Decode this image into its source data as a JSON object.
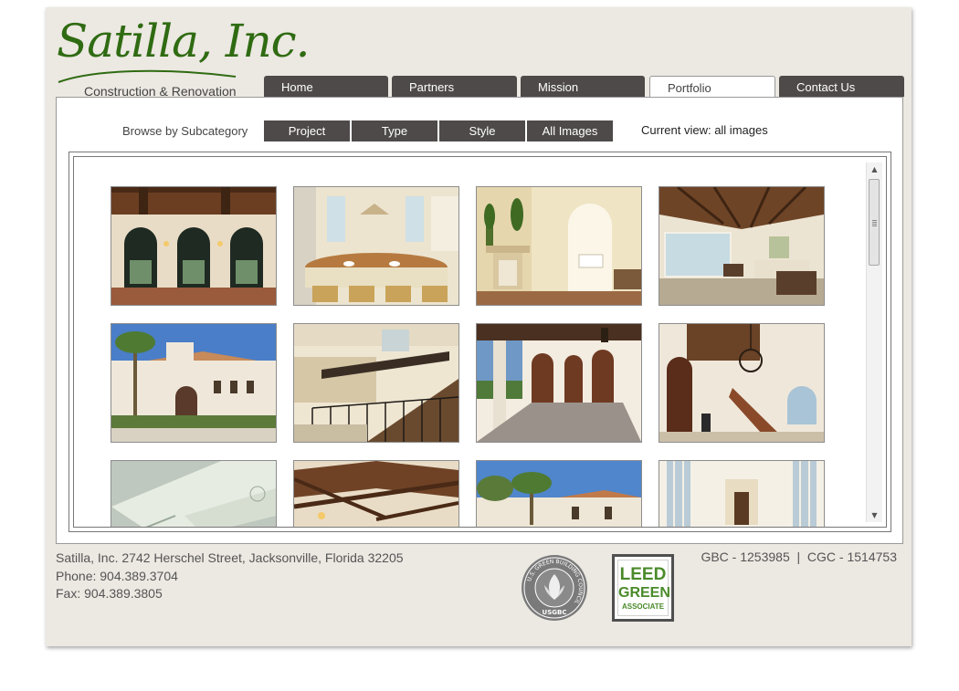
{
  "logo": {
    "name": "Satilla, Inc.",
    "tagline": "Construction & Renovation",
    "brand_color": "#2f6b12"
  },
  "nav": {
    "tabs": [
      {
        "label": "Home",
        "active": false
      },
      {
        "label": "Partners",
        "active": false
      },
      {
        "label": "Mission",
        "active": false
      },
      {
        "label": "Portfolio",
        "active": true
      },
      {
        "label": "Contact Us",
        "active": false
      }
    ]
  },
  "browse": {
    "label": "Browse by Subcategory",
    "filters": [
      "Project",
      "Type",
      "Style",
      "All Images"
    ],
    "current_view": "Current view: all images"
  },
  "gallery": {
    "thumbnails": [
      {
        "subject": "vaulted-hall-arched-doors"
      },
      {
        "subject": "kitchen-island-bar-stools"
      },
      {
        "subject": "living-room-fireplace-topiaries"
      },
      {
        "subject": "great-room-beamed-ceiling"
      },
      {
        "subject": "mediterranean-villa-exterior"
      },
      {
        "subject": "foyer-wrought-iron-staircase"
      },
      {
        "subject": "loggia-arched-columns"
      },
      {
        "subject": "stair-hall-chandelier"
      },
      {
        "subject": "ornate-ceiling-detail"
      },
      {
        "subject": "timber-trusses-ceiling"
      },
      {
        "subject": "villa-exterior-palm-trees"
      },
      {
        "subject": "white-hallway-windows"
      }
    ]
  },
  "footer": {
    "address": "Satilla, Inc. 2742 Herschel Street, Jacksonville, Florida 32205",
    "phone": "Phone: 904.389.3704",
    "fax": "Fax: 904.389.3805",
    "licenses": "GBC - 1253985  |  CGC - 1514753",
    "usgbc_ring_text": "U.S. GREEN BUILDING COUNCIL",
    "usgbc_mark": "USGBC",
    "leed_lines": [
      "LEED",
      "GREEN",
      "ASSOCIATE"
    ]
  },
  "colors": {
    "page_bg": "#ece8e2",
    "nav_tab": "#4e4a49",
    "leed_green": "#4a8a2a"
  }
}
